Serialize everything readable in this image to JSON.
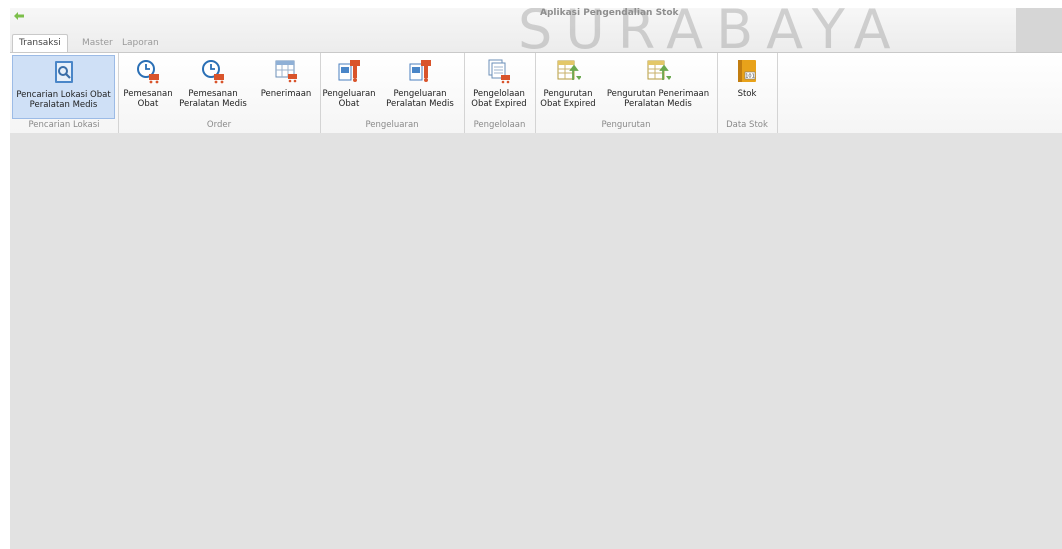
{
  "window": {
    "title": "Aplikasi Pengendalian Stok",
    "watermark": "SURABAYA"
  },
  "tabs": [
    {
      "label": "Transaksi",
      "active": true
    },
    {
      "label": "Master",
      "active": false
    },
    {
      "label": "Laporan",
      "active": false
    }
  ],
  "groups": {
    "pencarian": {
      "label": "Pencarian Lokasi",
      "buttons": [
        {
          "label": "Pencarian Lokasi Obat\nPeralatan Medis",
          "icon": "search-document-icon"
        }
      ]
    },
    "order": {
      "label": "Order",
      "buttons": [
        {
          "label": "Pemesanan\nObat",
          "icon": "clock-cart-icon"
        },
        {
          "label": "Pemesanan\nPeralatan Medis",
          "icon": "clock-cart-icon"
        },
        {
          "label": "Penerimaan",
          "icon": "table-cart-icon"
        }
      ]
    },
    "pengeluaran": {
      "label": "Pengeluaran",
      "buttons": [
        {
          "label": "Pengeluaran\nObat",
          "icon": "dispense-icon"
        },
        {
          "label": "Pengeluaran\nPeralatan Medis",
          "icon": "dispense-icon"
        }
      ]
    },
    "pengelolaan": {
      "label": "Pengelolaan",
      "buttons": [
        {
          "label": "Pengelolaan\nObat Expired",
          "icon": "stack-cart-icon"
        }
      ]
    },
    "pengurutan": {
      "label": "Pengurutan",
      "buttons": [
        {
          "label": "Pengurutan\nObat Expired",
          "icon": "sort-table-icon"
        },
        {
          "label": "Pengurutan Penerimaan\nPeralatan Medis",
          "icon": "sort-table-icon"
        }
      ]
    },
    "datastok": {
      "label": "Data Stok",
      "buttons": [
        {
          "label": "Stok",
          "icon": "book-icon"
        }
      ]
    }
  },
  "colors": {
    "accent": "#cfe0f6",
    "cart": "#d9542b",
    "clock": "#2a6fb5",
    "sort_arrow": "#6aa84f",
    "book": "#e8a21a"
  }
}
